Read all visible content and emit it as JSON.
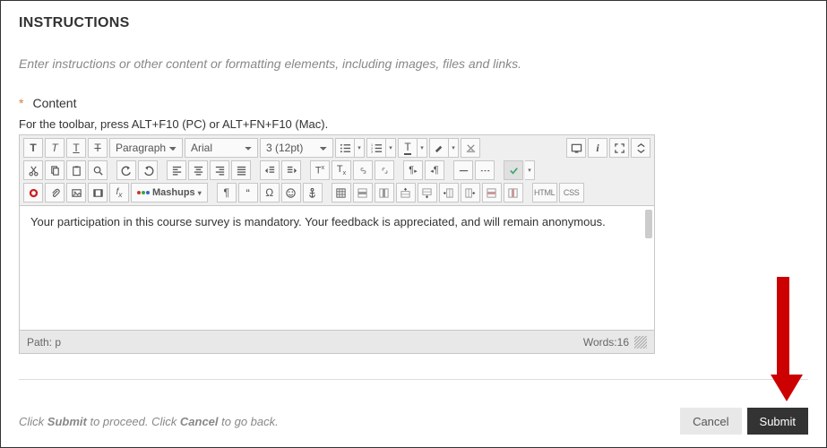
{
  "heading": "INSTRUCTIONS",
  "subtext": "Enter instructions or other content or formatting elements, including images, files and links.",
  "field": {
    "asterisk": "*",
    "label": "Content"
  },
  "hint": "For the toolbar, press ALT+F10 (PC) or ALT+FN+F10 (Mac).",
  "selects": {
    "paragraph": "Paragraph",
    "font": "Arial",
    "size": "3 (12pt)"
  },
  "mashups": "Mashups",
  "txtlabels": {
    "html": "HTML",
    "css": "CSS"
  },
  "content": "Your participation in this course survey is mandatory. Your feedback is appreciated, and will remain anonymous.",
  "status": {
    "path_label": "Path: ",
    "path_value": "p",
    "words_label": "Words:",
    "words_value": "16"
  },
  "footer": {
    "pre1": "Click ",
    "b1": "Submit",
    "mid": " to proceed. Click ",
    "b2": "Cancel",
    "post": " to go back.",
    "cancel": "Cancel",
    "submit": "Submit"
  }
}
